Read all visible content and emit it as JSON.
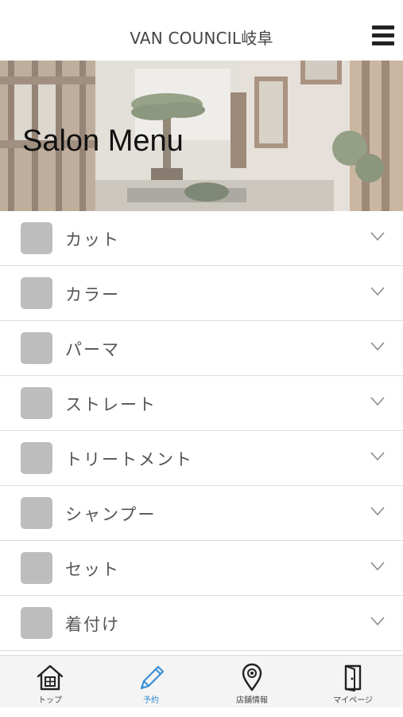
{
  "header": {
    "title": "VAN COUNCIL岐阜"
  },
  "hero": {
    "title": "Salon Menu"
  },
  "menu": {
    "items": [
      {
        "label": "カット"
      },
      {
        "label": "カラー"
      },
      {
        "label": "パーマ"
      },
      {
        "label": "ストレート"
      },
      {
        "label": "トリートメント"
      },
      {
        "label": "シャンプー"
      },
      {
        "label": "セット"
      },
      {
        "label": "着付け"
      }
    ]
  },
  "tabbar": {
    "tabs": [
      {
        "label": "トップ",
        "icon": "home-icon"
      },
      {
        "label": "予約",
        "icon": "pencil-icon",
        "active": true
      },
      {
        "label": "店舗情報",
        "icon": "map-pin-icon"
      },
      {
        "label": "マイページ",
        "icon": "door-icon"
      }
    ]
  },
  "colors": {
    "active": "#3a8fd6",
    "thumb": "#bdbdbd"
  }
}
